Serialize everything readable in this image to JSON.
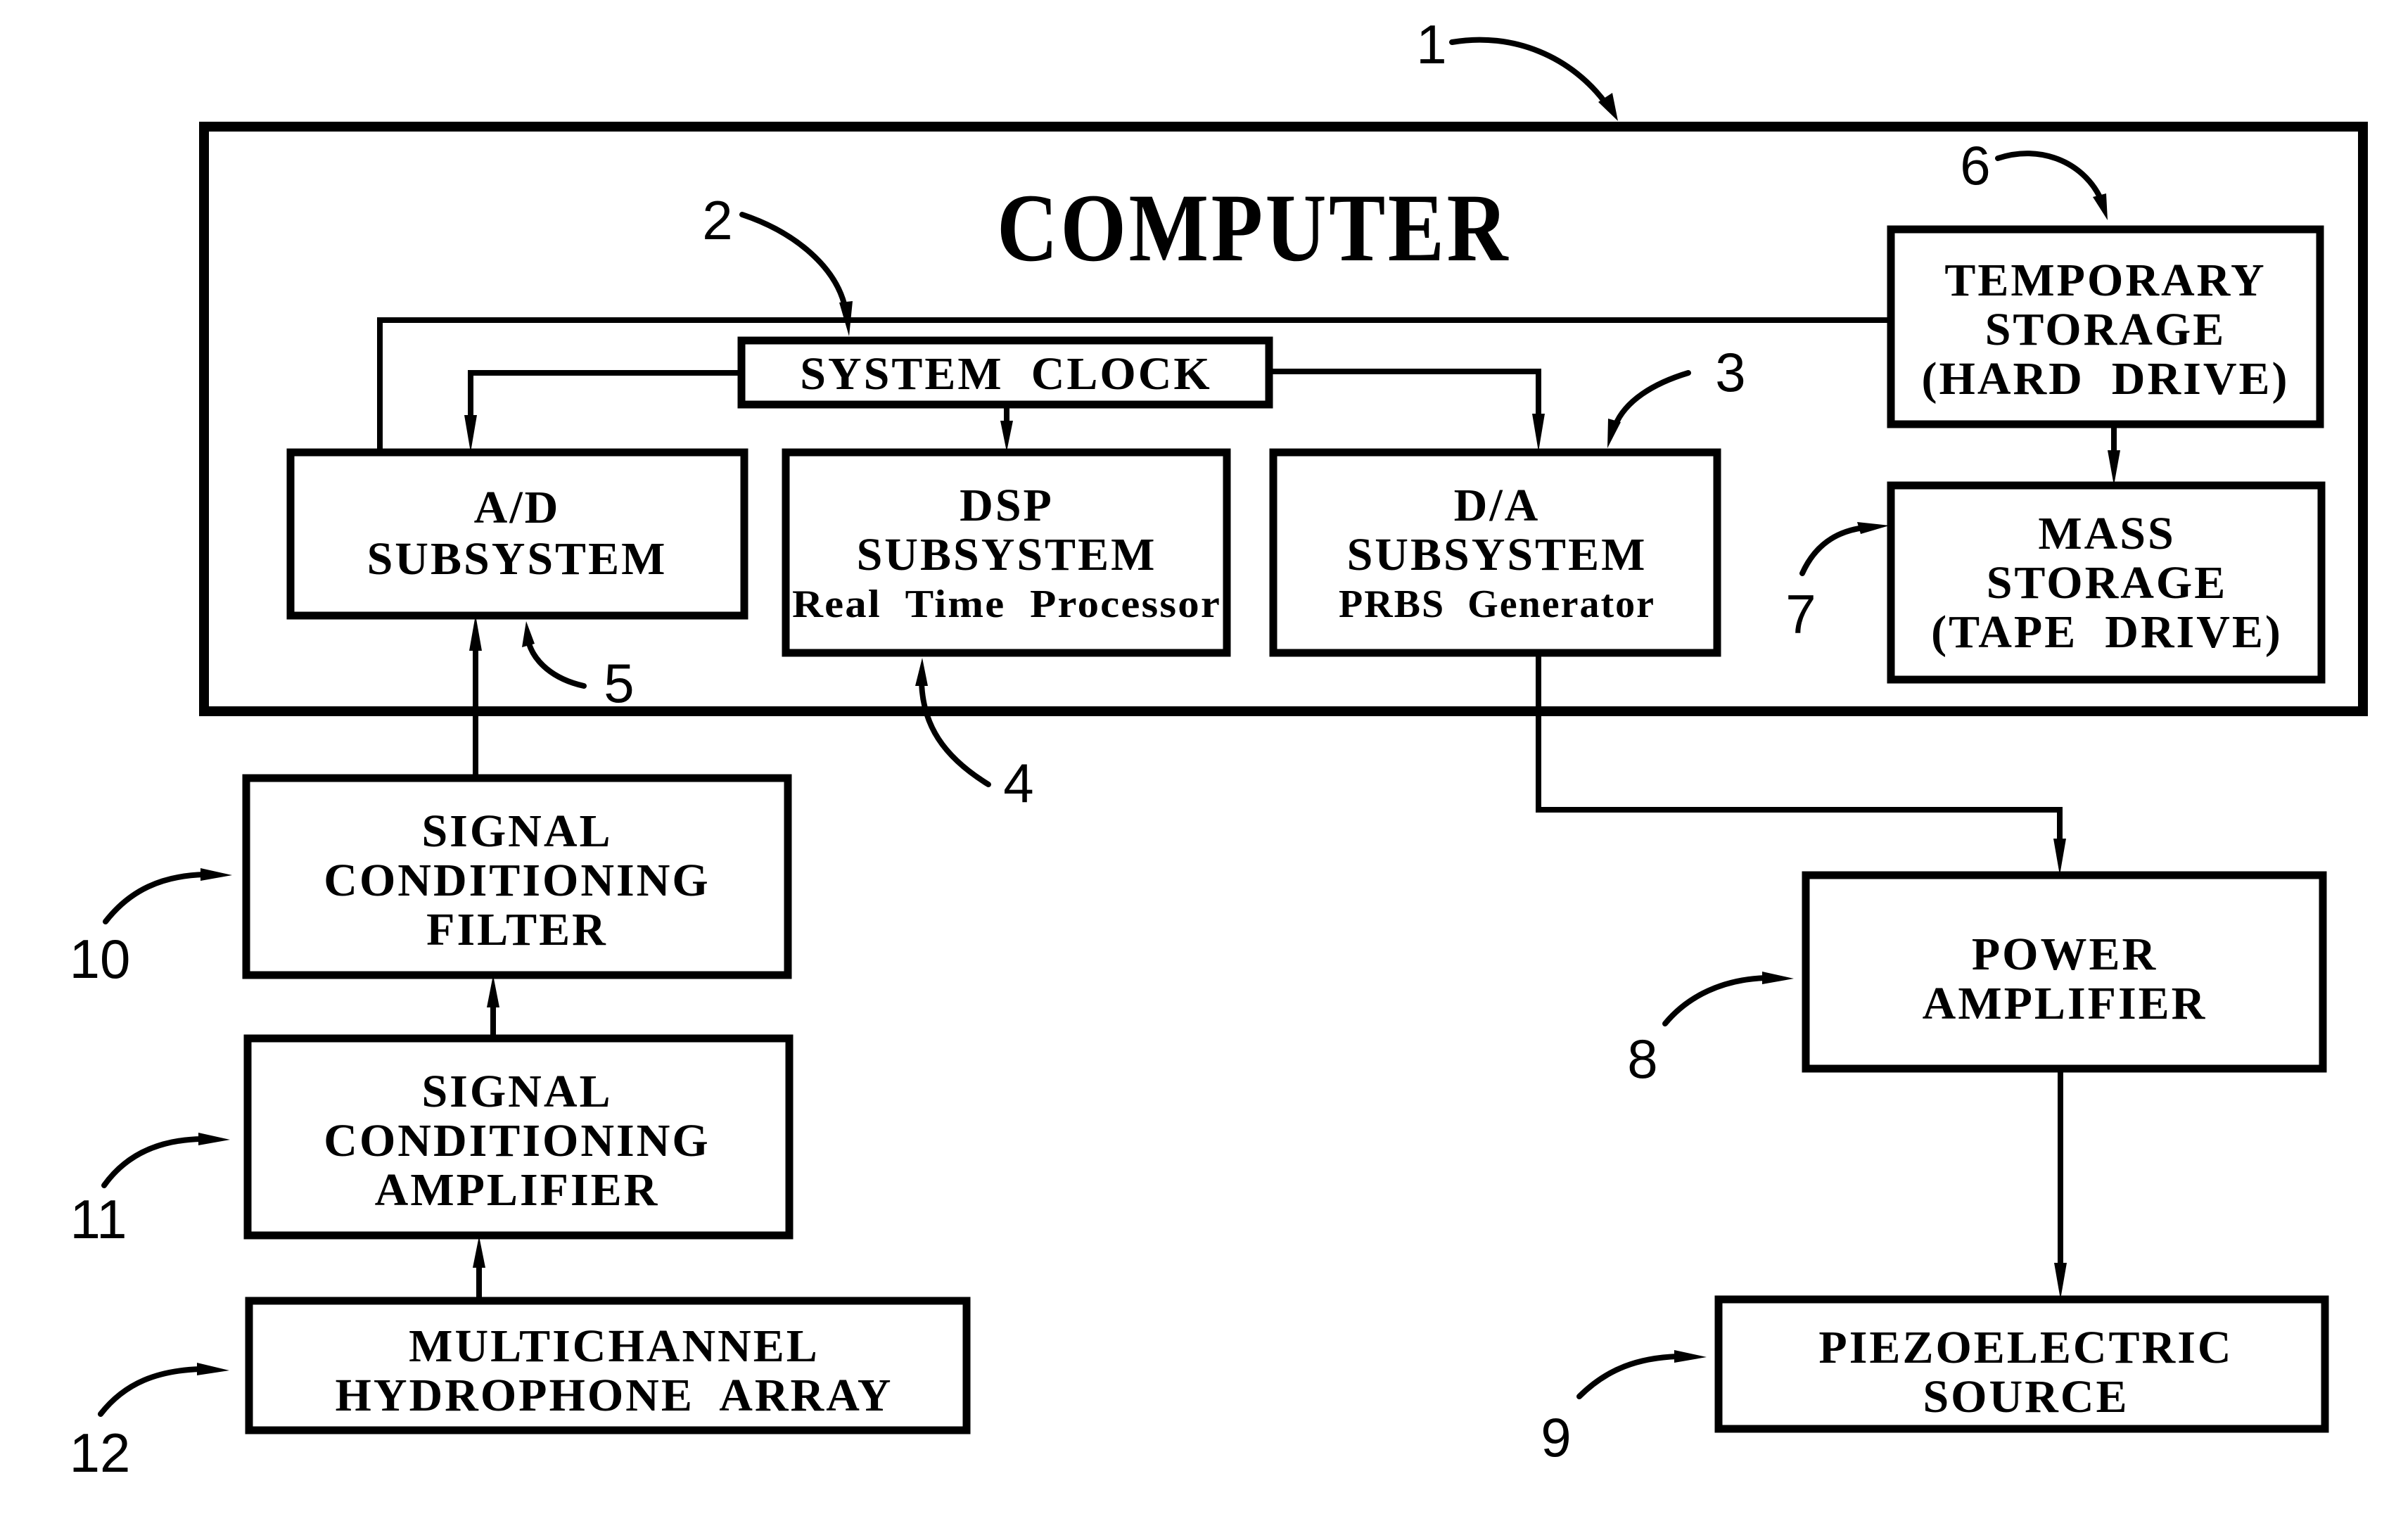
{
  "figure": {
    "computer_title": "COMPUTER",
    "reference_numerals": {
      "computer": "1",
      "system_clock": "2",
      "da_subsystem": "3",
      "dsp_subsystem": "4",
      "ad_subsystem": "5",
      "temporary_storage": "6",
      "mass_storage": "7",
      "power_amplifier": "8",
      "piezoelectric_source": "9",
      "signal_conditioning_filter": "10",
      "signal_conditioning_amplifier": "11",
      "hydrophone_array": "12"
    },
    "blocks": {
      "system_clock": {
        "lines": [
          "SYSTEM  CLOCK"
        ]
      },
      "ad_subsystem": {
        "lines": [
          "A/D",
          "SUBSYSTEM"
        ]
      },
      "dsp_subsystem": {
        "lines": [
          "DSP",
          "SUBSYSTEM"
        ],
        "sublabel": "Real  Time  Processor"
      },
      "da_subsystem": {
        "lines": [
          "D/A",
          "SUBSYSTEM"
        ],
        "sublabel": "PRBS  Generator"
      },
      "temporary_storage": {
        "lines": [
          "TEMPORARY",
          "STORAGE",
          "(HARD  DRIVE)"
        ]
      },
      "mass_storage": {
        "lines": [
          "MASS",
          "STORAGE",
          "(TAPE  DRIVE)"
        ]
      },
      "signal_conditioning_filter": {
        "lines": [
          "SIGNAL",
          "CONDITIONING",
          "FILTER"
        ]
      },
      "signal_conditioning_amplifier": {
        "lines": [
          "SIGNAL",
          "CONDITIONING",
          "AMPLIFIER"
        ]
      },
      "hydrophone_array": {
        "lines": [
          "MULTICHANNEL",
          "HYDROPHONE  ARRAY"
        ]
      },
      "power_amplifier": {
        "lines": [
          "POWER",
          "AMPLIFIER"
        ]
      },
      "piezoelectric_source": {
        "lines": [
          "PIEZOELECTRIC",
          "SOURCE"
        ]
      }
    },
    "connections": [
      {
        "from": "system_clock",
        "to": "ad_subsystem"
      },
      {
        "from": "system_clock",
        "to": "dsp_subsystem"
      },
      {
        "from": "system_clock",
        "to": "da_subsystem"
      },
      {
        "from": "ad_subsystem",
        "to": "temporary_storage"
      },
      {
        "from": "temporary_storage",
        "to": "mass_storage"
      },
      {
        "from": "hydrophone_array",
        "to": "signal_conditioning_amplifier"
      },
      {
        "from": "signal_conditioning_amplifier",
        "to": "signal_conditioning_filter"
      },
      {
        "from": "signal_conditioning_filter",
        "to": "ad_subsystem"
      },
      {
        "from": "da_subsystem",
        "to": "power_amplifier"
      },
      {
        "from": "power_amplifier",
        "to": "piezoelectric_source"
      }
    ]
  }
}
